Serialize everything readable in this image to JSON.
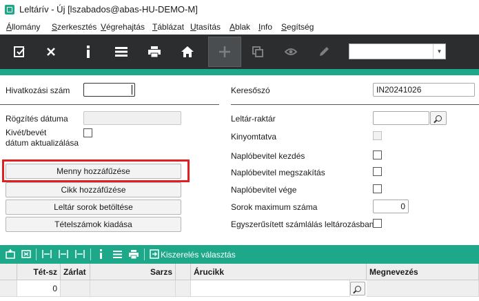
{
  "window": {
    "title": "Leltárív - Új  [lszabados@abas-HU-DEMO-M]"
  },
  "menu": [
    "Állomány",
    "Szerkesztés",
    "Végrehajtás",
    "Táblázat",
    "Utasítás",
    "Ablak",
    "Info",
    "Segítség"
  ],
  "menu_underline": [
    "Á",
    "S",
    "V",
    "T",
    "U",
    "A",
    "I",
    "S"
  ],
  "toolbar": {
    "icons": [
      "save-icon",
      "close-icon",
      "info-icon",
      "list-icon",
      "print-icon",
      "home-icon",
      "plus-icon",
      "copy-icon",
      "eye-icon",
      "pencil-icon"
    ],
    "combo_value": ""
  },
  "form": {
    "reference_no_label": "Hivatkozási szám",
    "reference_no_value": "",
    "search_label": "Keresőszó",
    "search_value": "IN20241026",
    "entry_date_label": "Rögzítés dátuma",
    "entry_date_value": "",
    "issue_receipt_label_1": "Kivét/bevét",
    "issue_receipt_label_2": "dátum aktualizálása",
    "inventory_warehouse_label": "Leltár-raktár",
    "inventory_warehouse_value": "",
    "printed_label": "Kinyomtatva",
    "log_start_label": "Naplóbevitel kezdés",
    "log_interrupt_label": "Naplóbevitel megszakítás",
    "log_end_label": "Naplóbevitel vége",
    "max_rows_label": "Sorok maximum száma",
    "max_rows_value": "0",
    "simplified_count_label": "Egyszerűsített számlálás leltározásban"
  },
  "buttons": {
    "add_qty": "Menny hozzáfűzése",
    "add_item": "Cikk hozzáfűzése",
    "load_rows": "Leltár sorok betöltése",
    "issue_lots": "Tételszámok kiadása"
  },
  "table_toolbar": {
    "packaging_label": "Kiszerelés választás"
  },
  "grid": {
    "columns": [
      "Tét-sz",
      "Zárlat",
      "Sarzs",
      "Árucikk",
      "Megnevezés"
    ],
    "rows": [
      {
        "tet_sz": "0",
        "zarlat": "",
        "sarzs": "",
        "arucikk": "",
        "megnevezes": ""
      }
    ]
  },
  "colors": {
    "accent": "#1ea88a",
    "toolbar_bg": "#2b2d2e",
    "highlight": "#e02020"
  }
}
